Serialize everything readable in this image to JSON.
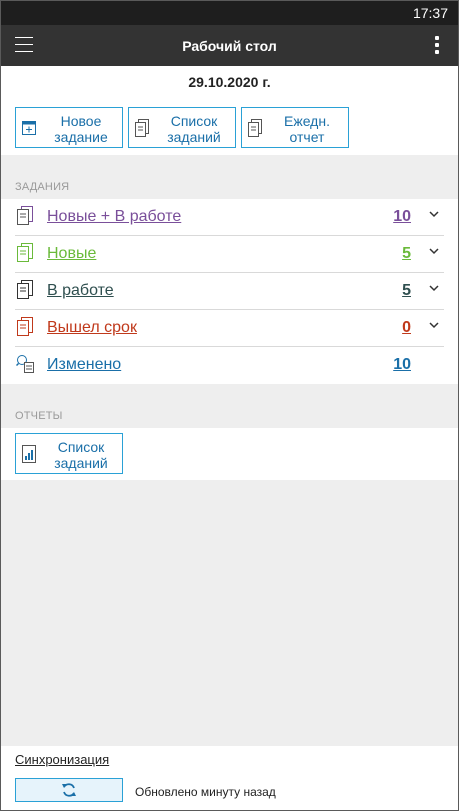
{
  "status_bar": {
    "time": "17:37"
  },
  "app_bar": {
    "title": "Рабочий стол"
  },
  "date": "29.10.2020 г.",
  "toolbar": {
    "buttons": [
      {
        "line1": "Новое",
        "line2": "задание",
        "icon": "new-task-icon"
      },
      {
        "line1": "Список",
        "line2": "заданий",
        "icon": "task-list-icon"
      },
      {
        "line1": "Ежедн.",
        "line2": "отчет",
        "icon": "daily-report-icon"
      }
    ]
  },
  "tasks_section": {
    "label": "ЗАДАНИЯ",
    "rows": [
      {
        "label": "Новые + В работе",
        "count": "10",
        "color": "#7a4f9a"
      },
      {
        "label": "Новые",
        "count": "5",
        "color": "#6aba3a"
      },
      {
        "label": "В работе",
        "count": "5",
        "color": "#2f4f4f"
      },
      {
        "label": "Вышел срок",
        "count": "0",
        "color": "#c0391b"
      },
      {
        "label": "Изменено",
        "count": "10",
        "color": "#1a6fa8"
      }
    ]
  },
  "reports_section": {
    "label": "ОТЧЕТЫ",
    "button": {
      "line1": "Список",
      "line2": "заданий"
    }
  },
  "sync": {
    "link": "Синхронизация",
    "status": "Обновлено минуту назад"
  },
  "colors": {
    "accent": "#2aa1d6",
    "appbar": "#333333"
  }
}
